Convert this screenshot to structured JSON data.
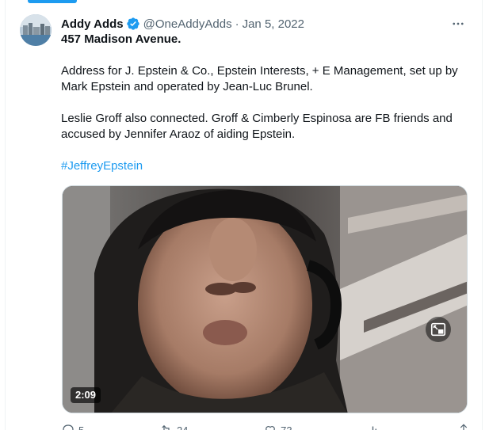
{
  "tweet": {
    "display_name": "Addy Adds",
    "handle": "@OneAddyAdds",
    "separator": "·",
    "date": "Jan 5, 2022",
    "more_icon": "more-icon",
    "verified_color": "#1d9bf0",
    "lines": {
      "headline": "457 Madison Avenue.",
      "para1": "Address for J. Epstein & Co., Epstein Interests, + E Management, set up by Mark Epstein and operated by Jean-Luc Brunel.",
      "para2": "Leslie Groff also connected. Groff & Cimberly Espinosa are FB friends and accused by Jennifer Araoz of aiding Epstein."
    },
    "hashtag": "#JeffreyEpstein",
    "video": {
      "duration": "2:09",
      "pip_icon": "picture-in-picture-icon"
    },
    "actions": {
      "reply_count": "5",
      "retweet_count": "24",
      "like_count": "73"
    }
  },
  "colors": {
    "accent": "#1d9bf0",
    "text": "#0f1419",
    "muted": "#536471",
    "border": "#cfd9de"
  }
}
